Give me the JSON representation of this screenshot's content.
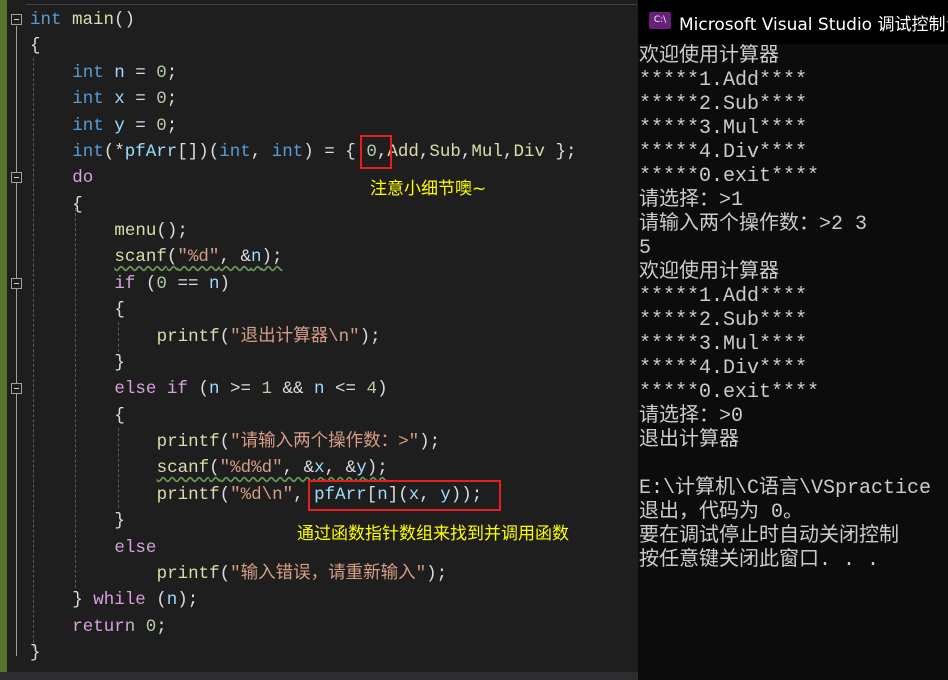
{
  "editor": {
    "lines": [
      {
        "indent": 0,
        "tokens": [
          [
            "int",
            "kw"
          ],
          [
            " "
          ],
          [
            "main",
            "fn"
          ],
          [
            "()",
            "pun"
          ]
        ]
      },
      {
        "indent": 0,
        "tokens": [
          [
            "{",
            "pun"
          ]
        ]
      },
      {
        "indent": 1,
        "tokens": [
          [
            "int",
            "kw"
          ],
          [
            " "
          ],
          [
            "n",
            "var"
          ],
          [
            " = ",
            "pun"
          ],
          [
            "0",
            "num"
          ],
          [
            ";",
            "pun"
          ]
        ]
      },
      {
        "indent": 1,
        "tokens": [
          [
            "int",
            "kw"
          ],
          [
            " "
          ],
          [
            "x",
            "var"
          ],
          [
            " = ",
            "pun"
          ],
          [
            "0",
            "num"
          ],
          [
            ";",
            "pun"
          ]
        ]
      },
      {
        "indent": 1,
        "tokens": [
          [
            "int",
            "kw"
          ],
          [
            " "
          ],
          [
            "y",
            "var"
          ],
          [
            " = ",
            "pun"
          ],
          [
            "0",
            "num"
          ],
          [
            ";",
            "pun"
          ]
        ]
      },
      {
        "indent": 1,
        "tokens": [
          [
            "int",
            "kw"
          ],
          [
            "(*",
            "pun"
          ],
          [
            "pfArr",
            "var"
          ],
          [
            "[])(",
            "pun"
          ],
          [
            "int",
            "kw"
          ],
          [
            ", ",
            "pun"
          ],
          [
            "int",
            "kw"
          ],
          [
            ") = { ",
            "pun"
          ],
          [
            "0",
            "num"
          ],
          [
            ",",
            "pun"
          ],
          [
            "Add",
            "fn"
          ],
          [
            ",",
            "pun"
          ],
          [
            "Sub",
            "fn"
          ],
          [
            ",",
            "pun"
          ],
          [
            "Mul",
            "fn"
          ],
          [
            ",",
            "pun"
          ],
          [
            "Div",
            "fn"
          ],
          [
            " };",
            "pun"
          ]
        ]
      },
      {
        "indent": 1,
        "tokens": [
          [
            "do",
            "ctl"
          ]
        ]
      },
      {
        "indent": 1,
        "tokens": [
          [
            "{",
            "pun"
          ]
        ]
      },
      {
        "indent": 2,
        "tokens": [
          [
            "menu",
            "fn"
          ],
          [
            "();",
            "pun"
          ]
        ]
      },
      {
        "indent": 2,
        "squiggle": true,
        "tokens": [
          [
            "scanf",
            "fn"
          ],
          [
            "(",
            "pun"
          ],
          [
            "\"%d\"",
            "str"
          ],
          [
            ", &",
            "pun"
          ],
          [
            "n",
            "var"
          ],
          [
            ");",
            "pun"
          ]
        ]
      },
      {
        "indent": 2,
        "tokens": [
          [
            "if",
            "ctl"
          ],
          [
            " (",
            "pun"
          ],
          [
            "0",
            "num"
          ],
          [
            " == ",
            "pun"
          ],
          [
            "n",
            "var"
          ],
          [
            ")",
            "pun"
          ]
        ]
      },
      {
        "indent": 2,
        "tokens": [
          [
            "{",
            "pun"
          ]
        ]
      },
      {
        "indent": 3,
        "tokens": [
          [
            "printf",
            "fn"
          ],
          [
            "(",
            "pun"
          ],
          [
            "\"退出计算器\\n\"",
            "str"
          ],
          [
            ");",
            "pun"
          ]
        ]
      },
      {
        "indent": 2,
        "tokens": [
          [
            "}",
            "pun"
          ]
        ]
      },
      {
        "indent": 2,
        "tokens": [
          [
            "else",
            "ctl"
          ],
          [
            " "
          ],
          [
            "if",
            "ctl"
          ],
          [
            " (",
            "pun"
          ],
          [
            "n",
            "var"
          ],
          [
            " >= ",
            "pun"
          ],
          [
            "1",
            "num"
          ],
          [
            " && ",
            "pun"
          ],
          [
            "n",
            "var"
          ],
          [
            " <= ",
            "pun"
          ],
          [
            "4",
            "num"
          ],
          [
            ")",
            "pun"
          ]
        ]
      },
      {
        "indent": 2,
        "tokens": [
          [
            "{",
            "pun"
          ]
        ]
      },
      {
        "indent": 3,
        "tokens": [
          [
            "printf",
            "fn"
          ],
          [
            "(",
            "pun"
          ],
          [
            "\"请输入两个操作数：>\"",
            "str"
          ],
          [
            ");",
            "pun"
          ]
        ]
      },
      {
        "indent": 3,
        "squiggle": true,
        "tokens": [
          [
            "scanf",
            "fn"
          ],
          [
            "(",
            "pun"
          ],
          [
            "\"%d%d\"",
            "str"
          ],
          [
            ", &",
            "pun"
          ],
          [
            "x",
            "var"
          ],
          [
            ", &",
            "pun"
          ],
          [
            "y",
            "var"
          ],
          [
            ");",
            "pun"
          ]
        ]
      },
      {
        "indent": 3,
        "tokens": [
          [
            "printf",
            "fn"
          ],
          [
            "(",
            "pun"
          ],
          [
            "\"%d\\n\"",
            "str"
          ],
          [
            ", ",
            "pun"
          ],
          [
            "pfArr",
            "var"
          ],
          [
            "[",
            "pun"
          ],
          [
            "n",
            "var"
          ],
          [
            "](",
            "pun"
          ],
          [
            "x",
            "var"
          ],
          [
            ", ",
            "pun"
          ],
          [
            "y",
            "var"
          ],
          [
            "));",
            "pun"
          ]
        ]
      },
      {
        "indent": 2,
        "tokens": [
          [
            "}",
            "pun"
          ]
        ]
      },
      {
        "indent": 2,
        "tokens": [
          [
            "else",
            "ctl"
          ]
        ]
      },
      {
        "indent": 3,
        "tokens": [
          [
            "printf",
            "fn"
          ],
          [
            "(",
            "pun"
          ],
          [
            "\"输入错误，请重新输入\"",
            "str"
          ],
          [
            ");",
            "pun"
          ]
        ]
      },
      {
        "indent": 1,
        "tokens": [
          [
            "} ",
            "pun"
          ],
          [
            "while",
            "ctl"
          ],
          [
            " (",
            "pun"
          ],
          [
            "n",
            "var"
          ],
          [
            ");",
            "pun"
          ]
        ]
      },
      {
        "indent": 1,
        "tokens": [
          [
            "return",
            "ctl"
          ],
          [
            " "
          ],
          [
            "0",
            "num"
          ],
          [
            ";",
            "pun"
          ]
        ]
      },
      {
        "indent": 0,
        "tokens": [
          [
            "}",
            "pun"
          ]
        ]
      }
    ],
    "annotations": {
      "note_zero": "注意小细节噢~",
      "note_call": "通过函数指针数组来找到并调用函数"
    }
  },
  "console": {
    "title": "Microsoft Visual Studio 调试控制台",
    "icon_label": "C:\\",
    "lines": [
      "欢迎使用计算器",
      "*****1.Add****",
      "*****2.Sub****",
      "*****3.Mul****",
      "*****4.Div****",
      "*****0.exit****",
      "请选择：>1",
      "请输入两个操作数：>2 3",
      "5",
      "欢迎使用计算器",
      "*****1.Add****",
      "*****2.Sub****",
      "*****3.Mul****",
      "*****4.Div****",
      "*****0.exit****",
      "请选择：>0",
      "退出计算器",
      "",
      "E:\\计算机\\C语言\\VSpractice",
      "退出，代码为 0。",
      "要在调试停止时自动关闭控制",
      "按任意键关闭此窗口. . ."
    ]
  },
  "colors": {
    "keyword": "#569cd6",
    "function": "#dcdcaa",
    "variable": "#9cdcfe",
    "number": "#b5cea8",
    "string": "#d69d85",
    "control": "#d8a0df",
    "annotation": "#ffff00",
    "highlight_box": "#e81e1e"
  }
}
